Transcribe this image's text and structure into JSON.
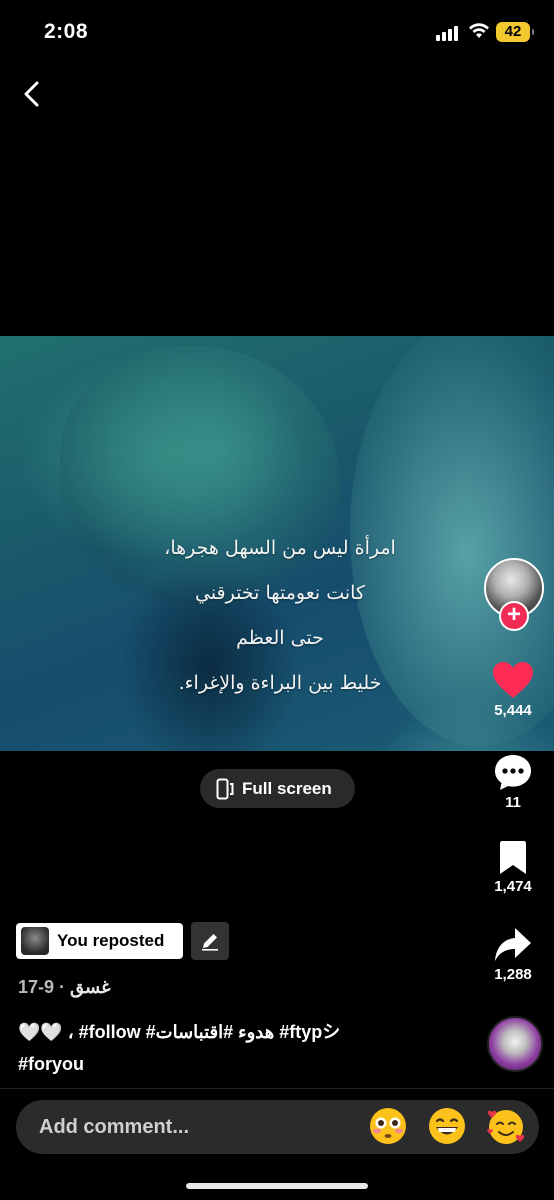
{
  "status_bar": {
    "time": "2:08",
    "battery": "42"
  },
  "video": {
    "caption_lines": [
      "امرأة ليس من السهل هجرها،",
      "كانت نعومتها تخترقني",
      "حتى العظم",
      "خليط بين البراءة والإغراء."
    ]
  },
  "fullscreen_label": "Full screen",
  "rail": {
    "likes": "5,444",
    "comments": "11",
    "saves": "1,474",
    "shares": "1,288"
  },
  "repost": {
    "label": "You reposted"
  },
  "author": {
    "name": "غسق",
    "separator": " · ",
    "date": "9-17"
  },
  "description": {
    "line1": "🤍🤍 ، #follow #هدوء #اقتباسات #ftypシ",
    "line2": "#foryou"
  },
  "comment": {
    "placeholder": "Add comment..."
  },
  "colors": {
    "like": "#fe2c55",
    "follow": "#f02c56",
    "battery": "#f3c82f"
  }
}
